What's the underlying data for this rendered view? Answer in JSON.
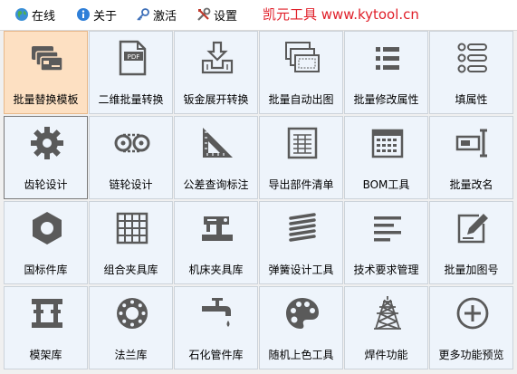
{
  "menubar": {
    "items": [
      {
        "label": "在线",
        "icon": "globe-icon"
      },
      {
        "label": "关于",
        "icon": "info-icon"
      },
      {
        "label": "激活",
        "icon": "key-icon"
      },
      {
        "label": "设置",
        "icon": "tools-icon"
      }
    ],
    "brand": "凯元工具 www.kytool.cn",
    "brand_color": "#e0202a"
  },
  "tiles": [
    {
      "label": "批量替换模板",
      "icon": "cards-icon"
    },
    {
      "label": "二维批量转换",
      "icon": "pdf-icon"
    },
    {
      "label": "钣金展开转换",
      "icon": "sheet-metal-icon"
    },
    {
      "label": "批量自动出图",
      "icon": "drawings-icon"
    },
    {
      "label": "批量修改属性",
      "icon": "list-icon"
    },
    {
      "label": "填属性",
      "icon": "properties-list-icon"
    },
    {
      "label": "齿轮设计",
      "icon": "gear-icon"
    },
    {
      "label": "链轮设计",
      "icon": "chain-icon"
    },
    {
      "label": "公差查询标注",
      "icon": "set-square-icon"
    },
    {
      "label": "导出部件清单",
      "icon": "spreadsheet-icon"
    },
    {
      "label": "BOM工具",
      "icon": "calendar-table-icon"
    },
    {
      "label": "批量改名",
      "icon": "rename-icon"
    },
    {
      "label": "国标件库",
      "icon": "hex-nut-icon"
    },
    {
      "label": "组合夹具库",
      "icon": "grid-plate-icon"
    },
    {
      "label": "机床夹具库",
      "icon": "sewing-machine-icon"
    },
    {
      "label": "弹簧设计工具",
      "icon": "spring-icon"
    },
    {
      "label": "技术要求管理",
      "icon": "text-lines-icon"
    },
    {
      "label": "批量加图号",
      "icon": "edit-icon"
    },
    {
      "label": "模架库",
      "icon": "mold-base-icon"
    },
    {
      "label": "法兰库",
      "icon": "flange-icon"
    },
    {
      "label": "石化管件库",
      "icon": "faucet-icon"
    },
    {
      "label": "随机上色工具",
      "icon": "palette-icon"
    },
    {
      "label": "焊件功能",
      "icon": "tower-icon"
    },
    {
      "label": "更多功能预览",
      "icon": "plus-circle-icon"
    }
  ]
}
